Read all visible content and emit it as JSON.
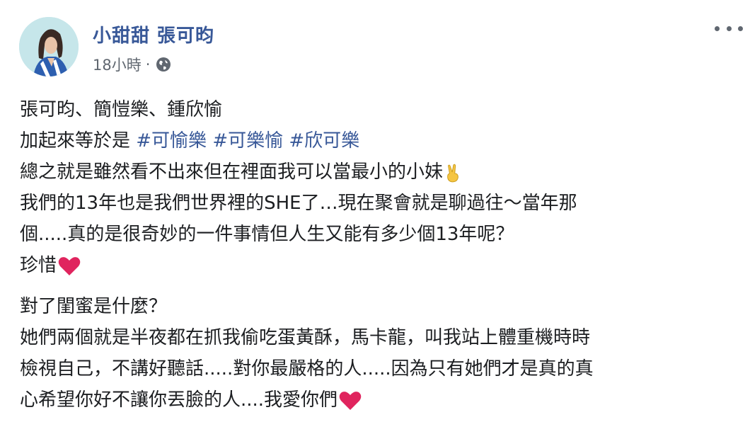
{
  "author": {
    "name": "小甜甜 張可昀",
    "time": "18小時",
    "separator": "·",
    "privacy_icon": "globe-icon"
  },
  "menu_icon": "more-options-icon",
  "post": {
    "line1": "張可昀、簡愷樂、鍾欣愉",
    "line2_prefix": "加起來等於是 ",
    "hashtags": [
      "#可愉樂",
      "#可樂愉",
      "#欣可樂"
    ],
    "line3": "總之就是雖然看不出來但在裡面我可以當最小的小妹",
    "line3_emoji": "victory-hand-emoji",
    "line4": "我們的13年也是我們世界裡的SHE了…現在聚會就是聊過往～當年那",
    "line5": "個.....真的是很奇妙的一件事情但人生又能有多少個13年呢？",
    "line6": "珍惜",
    "line6_emoji": "red-heart-emoji",
    "line7": "對了閨蜜是什麼？",
    "line8": "她們兩個就是半夜都在抓我偷吃蛋黃酥，馬卡龍，叫我站上體重機時時",
    "line9": "檢視自己，不講好聽話.....對你最嚴格的人.....因為只有她們才是真的真",
    "line10": "心希望你好不讓你丟臉的人....我愛你們",
    "line10_emoji": "red-heart-emoji"
  },
  "colors": {
    "link": "#385898",
    "text": "#1c1e21",
    "meta": "#606770",
    "heart": "#e0245e"
  }
}
